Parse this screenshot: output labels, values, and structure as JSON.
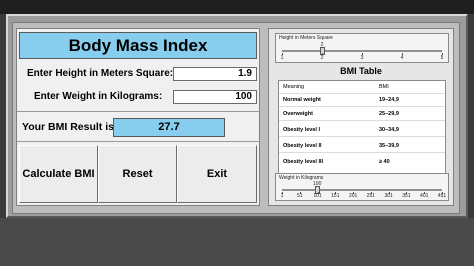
{
  "app": {
    "title": "Body Mass Index"
  },
  "inputs": {
    "height_label": "Enter Height in Meters Square:",
    "height_value": "1.9",
    "weight_label": "Enter Weight in Kilograms:",
    "weight_value": "100"
  },
  "result": {
    "label": "Your BMI Result is:",
    "value": "27.7"
  },
  "buttons": {
    "calculate": "Calculate BMI",
    "reset": "Reset",
    "exit": "Exit"
  },
  "height_slider": {
    "title": "Height in Meters Square",
    "value_label": "2",
    "value": 2,
    "min": 1,
    "max": 5,
    "ticks": [
      "1",
      "2",
      "3",
      "4",
      "5"
    ]
  },
  "bmi_table": {
    "title": "BMI Table",
    "header": {
      "meaning": "Meaning",
      "bmi": "BMI"
    },
    "rows": [
      {
        "meaning": "Normal weight",
        "bmi": "19–24,9"
      },
      {
        "meaning": "Overweight",
        "bmi": "25–29,9"
      },
      {
        "meaning": "Obesity level I",
        "bmi": "30–34,9"
      },
      {
        "meaning": "Obesity level II",
        "bmi": "35–39,9"
      },
      {
        "meaning": "Obesity level III",
        "bmi": "≥ 40"
      }
    ]
  },
  "weight_slider": {
    "title": "Weight in Kilograms",
    "value_label": "100",
    "value": 100,
    "min": 1,
    "max": 451,
    "ticks": [
      "1",
      "51",
      "101",
      "151",
      "201",
      "251",
      "301",
      "351",
      "401",
      "451"
    ]
  },
  "colors": {
    "accent": "#87cdee",
    "frame": "#9c9c9c",
    "panel": "#f0f0f0"
  }
}
